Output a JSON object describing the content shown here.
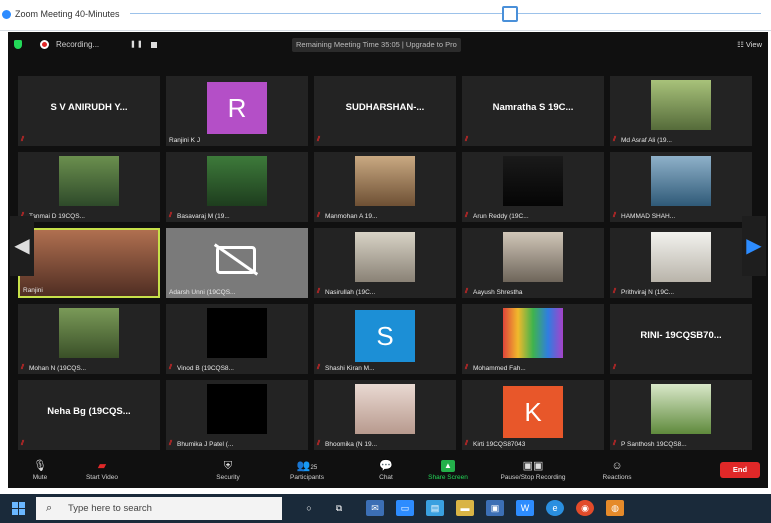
{
  "window": {
    "title": "Zoom Meeting 40-Minutes"
  },
  "topbar": {
    "recording_label": "Recording...",
    "remaining_text": "Remaining Meeting Time 35:05 | Upgrade to Pro",
    "view_label": "View"
  },
  "tiles": [
    {
      "kind": "name",
      "text": "S V ANIRUDH Y...",
      "caption": "",
      "muted": true
    },
    {
      "kind": "letter",
      "letter": "R",
      "color": "#b44fc7",
      "caption": "Ranjini K J",
      "muted": false
    },
    {
      "kind": "name",
      "text": "SUDHARSHAN-...",
      "caption": "",
      "muted": true
    },
    {
      "kind": "name",
      "text": "Namratha S 19C...",
      "caption": "",
      "muted": true
    },
    {
      "kind": "photo",
      "scene": "outdoor-person",
      "caption": "Md Asraf Ali (19...",
      "muted": true
    },
    {
      "kind": "photo",
      "scene": "trees",
      "caption": "Tanmai D 19CQS...",
      "muted": true
    },
    {
      "kind": "photo",
      "scene": "person-green",
      "caption": "Basavaraj M (19...",
      "muted": true
    },
    {
      "kind": "photo",
      "scene": "person-beige",
      "caption": "Manmohan A 19...",
      "muted": true
    },
    {
      "kind": "photo",
      "scene": "dark-text",
      "caption": "Arun Reddy (19C...",
      "muted": true
    },
    {
      "kind": "photo",
      "scene": "sea",
      "caption": "HAMMAD SHAH...",
      "muted": true
    },
    {
      "kind": "video",
      "scene": "woman",
      "caption": "Ranjini",
      "muted": false,
      "active": true
    },
    {
      "kind": "videooff",
      "caption": "Adarsh Unni (19CQS...",
      "muted": false
    },
    {
      "kind": "photo",
      "scene": "person-light",
      "caption": "Nasirullah (19C...",
      "muted": true
    },
    {
      "kind": "photo",
      "scene": "room",
      "caption": "Aayush Shrestha",
      "muted": true
    },
    {
      "kind": "photo",
      "scene": "person-white",
      "caption": "Prithviraj N (19C...",
      "muted": true
    },
    {
      "kind": "photo",
      "scene": "person-outdoor2",
      "caption": "Mohan N (19CQS...",
      "muted": true
    },
    {
      "kind": "black",
      "caption": "Vinod B (19CQS8...",
      "muted": true
    },
    {
      "kind": "letter",
      "letter": "S",
      "color": "#1c8fd6",
      "caption": "Shashi Kiran M...",
      "muted": true
    },
    {
      "kind": "photo",
      "scene": "colorful",
      "caption": "Mohammed Fah...",
      "muted": true
    },
    {
      "kind": "name",
      "text": "RINI- 19CQSB70...",
      "caption": "",
      "muted": true
    },
    {
      "kind": "name",
      "text": "Neha Bg (19CQS...",
      "caption": "",
      "muted": true
    },
    {
      "kind": "black",
      "caption": "Bhumika J Patel (...",
      "muted": true
    },
    {
      "kind": "photo",
      "scene": "girl",
      "caption": "Bhoomika (N 19...",
      "muted": true
    },
    {
      "kind": "letter",
      "letter": "K",
      "color": "#e8572a",
      "caption": "Kirti 19CQS87043",
      "muted": true
    },
    {
      "kind": "photo",
      "scene": "flowers",
      "caption": "P Santhosh 19CQS8...",
      "muted": true
    }
  ],
  "nav": {
    "left": "◀",
    "right": "▶"
  },
  "toolbar": {
    "mute": "Mute",
    "stop_video": "Start Video",
    "security": "Security",
    "participants": "Participants",
    "participants_count": "25",
    "chat": "Chat",
    "share_screen": "Share Screen",
    "record": "Pause/Stop Recording",
    "reactions": "Reactions",
    "end": "End"
  },
  "taskbar": {
    "search_placeholder": "Type here to search"
  }
}
